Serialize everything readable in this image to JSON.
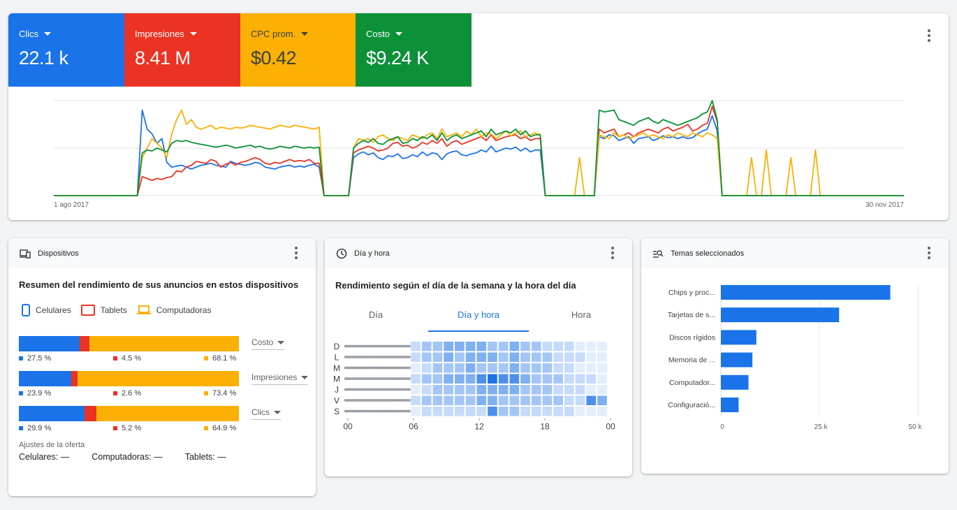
{
  "metrics": [
    {
      "label": "Clics",
      "value": "22.1 k",
      "color": "#1a73e8"
    },
    {
      "label": "Impresiones",
      "value": "8.41 M",
      "color": "#ea3323"
    },
    {
      "label": "CPC prom.",
      "value": "$0.42",
      "color": "#fbb003"
    },
    {
      "label": "Costo",
      "value": "$9.24 K",
      "color": "#0c9038"
    }
  ],
  "chart_data": {
    "type": "line",
    "x_start_label": "1 ago 2017",
    "x_end_label": "30 nov 2017",
    "series": [
      {
        "name": "Clics",
        "color": "#1a73e8",
        "values": [
          0,
          0,
          0,
          0,
          0,
          0,
          0,
          0,
          0,
          0,
          0,
          0,
          0,
          0,
          0,
          0,
          0,
          0,
          90,
          70,
          65,
          55,
          60,
          35,
          30,
          31,
          32,
          30,
          28,
          30,
          32,
          33,
          34,
          32,
          31,
          30,
          36,
          34,
          33,
          32,
          33,
          35,
          34,
          30,
          29,
          28,
          30,
          31,
          32,
          30,
          31,
          30,
          32,
          33,
          30,
          0,
          0,
          0,
          0,
          0,
          0,
          40,
          44,
          46,
          43,
          45,
          40,
          38,
          42,
          41,
          44,
          39,
          40,
          43,
          41,
          46,
          42,
          45,
          44,
          38,
          44,
          46,
          47,
          43,
          42,
          44,
          45,
          48,
          46,
          52,
          46,
          48,
          50,
          49,
          51,
          47,
          50,
          46,
          48,
          48,
          0,
          0,
          0,
          0,
          0,
          0,
          0,
          0,
          0,
          0,
          0,
          62,
          60,
          64,
          63,
          58,
          60,
          62,
          55,
          60,
          61,
          62,
          58,
          60,
          63,
          61,
          62,
          60,
          62,
          60,
          61,
          65,
          68,
          70,
          84,
          68,
          0,
          0,
          0,
          0,
          0,
          0,
          0,
          0,
          0,
          0,
          0,
          0,
          0,
          0,
          0,
          0,
          0,
          0,
          0,
          0,
          0,
          0,
          0,
          0,
          0,
          0,
          0,
          0,
          0,
          0,
          0,
          0,
          0,
          0,
          0,
          0,
          0,
          0
        ]
      },
      {
        "name": "Impresiones",
        "color": "#ea3323",
        "values": [
          0,
          0,
          0,
          0,
          0,
          0,
          0,
          0,
          0,
          0,
          0,
          0,
          0,
          0,
          0,
          0,
          0,
          0,
          20,
          18,
          16,
          18,
          17,
          19,
          20,
          26,
          25,
          30,
          32,
          36,
          35,
          34,
          38,
          36,
          30,
          33,
          35,
          32,
          35,
          36,
          38,
          40,
          38,
          34,
          33,
          35,
          34,
          36,
          38,
          36,
          37,
          36,
          38,
          34,
          34,
          0,
          0,
          0,
          0,
          0,
          0,
          45,
          48,
          50,
          52,
          50,
          47,
          48,
          50,
          55,
          56,
          52,
          53,
          50,
          52,
          56,
          54,
          58,
          55,
          60,
          52,
          56,
          58,
          54,
          56,
          58,
          60,
          62,
          58,
          64,
          58,
          60,
          62,
          63,
          64,
          60,
          62,
          58,
          60,
          60,
          0,
          0,
          0,
          0,
          0,
          0,
          0,
          0,
          0,
          0,
          0,
          70,
          66,
          68,
          70,
          62,
          64,
          66,
          62,
          66,
          68,
          70,
          68,
          66,
          70,
          72,
          68,
          70,
          72,
          75,
          68,
          70,
          74,
          76,
          94,
          78,
          0,
          0,
          0,
          0,
          0,
          0,
          0,
          0,
          0,
          0,
          0,
          0,
          0,
          0,
          0,
          0,
          0,
          0,
          0,
          0,
          0,
          0,
          0,
          0,
          0,
          0,
          0,
          0,
          0,
          0,
          0,
          0,
          0,
          0,
          0,
          0,
          0,
          0
        ]
      },
      {
        "name": "CPC prom.",
        "color": "#fbb003",
        "values": [
          0,
          0,
          0,
          0,
          0,
          0,
          0,
          0,
          0,
          0,
          0,
          0,
          0,
          0,
          0,
          0,
          0,
          0,
          40,
          50,
          60,
          55,
          50,
          40,
          65,
          80,
          90,
          75,
          80,
          72,
          70,
          72,
          74,
          70,
          72,
          71,
          70,
          72,
          71,
          72,
          74,
          73,
          72,
          71,
          70,
          72,
          74,
          73,
          72,
          74,
          73,
          72,
          71,
          70,
          72,
          0,
          0,
          0,
          0,
          0,
          0,
          50,
          60,
          58,
          60,
          56,
          62,
          64,
          60,
          58,
          62,
          60,
          58,
          64,
          62,
          60,
          64,
          66,
          60,
          70,
          62,
          64,
          66,
          62,
          68,
          64,
          70,
          62,
          66,
          65,
          60,
          64,
          68,
          63,
          66,
          68,
          62,
          64,
          66,
          64,
          0,
          0,
          0,
          0,
          0,
          0,
          0,
          40,
          0,
          0,
          0,
          64,
          62,
          60,
          66,
          62,
          64,
          60,
          62,
          64,
          66,
          62,
          64,
          62,
          60,
          64,
          62,
          66,
          64,
          62,
          66,
          64,
          62,
          66,
          64,
          60,
          0,
          0,
          0,
          0,
          0,
          0,
          40,
          0,
          0,
          48,
          0,
          0,
          0,
          0,
          40,
          0,
          0,
          0,
          0,
          48,
          0,
          0,
          0,
          0,
          0,
          0,
          0,
          0,
          0,
          0,
          0,
          0,
          0,
          0,
          0,
          0,
          0,
          0
        ]
      },
      {
        "name": "Costo",
        "color": "#0c9038",
        "values": [
          0,
          0,
          0,
          0,
          0,
          0,
          0,
          0,
          0,
          0,
          0,
          0,
          0,
          0,
          0,
          0,
          0,
          0,
          45,
          48,
          47,
          50,
          48,
          46,
          55,
          58,
          57,
          58,
          56,
          55,
          54,
          53,
          52,
          51,
          52,
          53,
          52,
          50,
          51,
          52,
          53,
          51,
          52,
          50,
          49,
          50,
          52,
          51,
          50,
          52,
          51,
          50,
          51,
          50,
          51,
          0,
          0,
          0,
          0,
          0,
          0,
          50,
          55,
          58,
          56,
          60,
          55,
          54,
          58,
          60,
          62,
          55,
          56,
          60,
          58,
          62,
          60,
          64,
          58,
          66,
          58,
          62,
          64,
          60,
          62,
          64,
          66,
          68,
          62,
          70,
          64,
          66,
          68,
          66,
          70,
          64,
          68,
          62,
          64,
          64,
          0,
          0,
          0,
          0,
          0,
          0,
          0,
          0,
          0,
          0,
          0,
          90,
          88,
          89,
          90,
          80,
          78,
          76,
          74,
          78,
          80,
          82,
          78,
          76,
          80,
          78,
          76,
          74,
          76,
          78,
          80,
          82,
          86,
          88,
          100,
          80,
          0,
          0,
          0,
          0,
          0,
          0,
          0,
          0,
          0,
          0,
          0,
          0,
          0,
          0,
          0,
          0,
          0,
          0,
          0,
          0,
          0,
          0,
          0,
          0,
          0,
          0,
          0,
          0,
          0,
          0,
          0,
          0,
          0,
          0,
          0,
          0,
          0,
          0
        ]
      }
    ]
  },
  "devices": {
    "title": "Dispositivos",
    "subtitle": "Resumen del rendimiento de sus anuncios en estos dispositivos",
    "legend": [
      "Celulares",
      "Tablets",
      "Computadoras"
    ],
    "colors": [
      "#1a73e8",
      "#ea3323",
      "#fbb003"
    ],
    "rows": [
      {
        "values": [
          27.5,
          4.5,
          68.1
        ],
        "labels": [
          "27.5 %",
          "4.5 %",
          "68.1 %"
        ],
        "metric": "Costo"
      },
      {
        "values": [
          23.9,
          2.6,
          73.4
        ],
        "labels": [
          "23.9 %",
          "2.6 %",
          "73.4 %"
        ],
        "metric": "Impresiones"
      },
      {
        "values": [
          29.9,
          5.2,
          64.9
        ],
        "labels": [
          "29.9 %",
          "5.2 %",
          "64.9 %"
        ],
        "metric": "Clics"
      }
    ],
    "bid_title": "Ajustes de la oferta",
    "bid_items": [
      "Celulares: —",
      "Computadoras: —",
      "Tablets: —"
    ]
  },
  "daytime": {
    "title": "Día y hora",
    "subtitle": "Rendimiento según el día de la semana y la hora del día",
    "tabs": [
      "Día",
      "Día y hora",
      "Hora"
    ],
    "active_tab": 1,
    "day_labels": [
      "D",
      "L",
      "M",
      "M",
      "J",
      "V",
      "S"
    ],
    "hour_labels": [
      "00",
      "06",
      "12",
      "18",
      "00"
    ],
    "heat": [
      [
        0,
        0,
        0,
        0,
        0,
        0,
        2,
        3,
        3,
        4,
        4,
        4,
        4,
        3,
        3,
        4,
        3,
        3,
        2,
        2,
        2,
        1,
        1,
        1
      ],
      [
        0,
        0,
        0,
        0,
        0,
        0,
        2,
        3,
        3,
        4,
        3,
        4,
        4,
        4,
        3,
        4,
        3,
        3,
        3,
        2,
        2,
        2,
        1,
        1
      ],
      [
        0,
        0,
        0,
        0,
        0,
        0,
        1,
        2,
        3,
        3,
        3,
        4,
        3,
        3,
        3,
        4,
        3,
        3,
        3,
        2,
        2,
        1,
        1,
        1
      ],
      [
        0,
        0,
        0,
        0,
        0,
        0,
        2,
        3,
        3,
        4,
        4,
        4,
        5,
        6,
        5,
        5,
        4,
        3,
        3,
        3,
        2,
        2,
        2,
        1
      ],
      [
        0,
        0,
        0,
        0,
        0,
        0,
        1,
        2,
        3,
        3,
        3,
        3,
        4,
        4,
        4,
        4,
        3,
        3,
        3,
        2,
        2,
        2,
        1,
        1
      ],
      [
        0,
        0,
        0,
        0,
        0,
        0,
        2,
        3,
        3,
        3,
        3,
        3,
        4,
        4,
        3,
        3,
        3,
        3,
        3,
        3,
        2,
        2,
        5,
        4
      ],
      [
        0,
        0,
        0,
        0,
        0,
        0,
        1,
        2,
        2,
        2,
        2,
        2,
        2,
        5,
        3,
        3,
        2,
        2,
        2,
        2,
        2,
        1,
        1,
        1
      ]
    ]
  },
  "topics": {
    "title": "Temas seleccionados",
    "categories": [
      "Chips y proc...",
      "Tarjetas de s...",
      "Discos rígidos",
      "Memoria de ...",
      "Computador...",
      "Configuració..."
    ],
    "values": [
      43000,
      30000,
      9000,
      8000,
      7000,
      4500
    ],
    "ticks": [
      "0",
      "25 k",
      "50 k"
    ],
    "xmax": 50000,
    "color": "#1a73e8"
  }
}
